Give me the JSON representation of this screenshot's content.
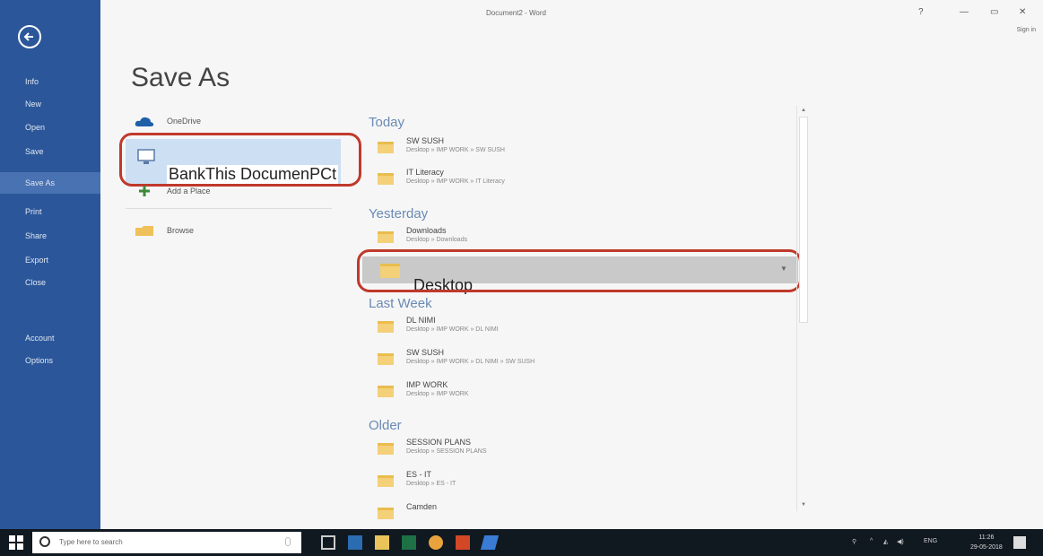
{
  "window": {
    "doc_title": "Document2 - Word",
    "help": "?",
    "minimize": "—",
    "restore": "▭",
    "close": "✕",
    "sign_in": "Sign in"
  },
  "nav": [
    "Info",
    "New",
    "Open",
    "Save",
    "Save As",
    "Print",
    "Share",
    "Export",
    "Close",
    "Account",
    "Options"
  ],
  "heading": "Save As",
  "locations": {
    "onedrive": "OneDrive",
    "this_pc": "BankThis DocumenPCt",
    "add_place": "Add a Place",
    "browse": "Browse"
  },
  "sections": {
    "today": "Today",
    "yesterday": "Yesterday",
    "last_week": "Last Week",
    "older": "Older"
  },
  "folders": {
    "today": [
      {
        "name": "SW SUSH",
        "path": "Desktop » IMP WORK » SW SUSH"
      },
      {
        "name": "IT Literacy",
        "path": "Desktop » IMP WORK » IT Literacy"
      }
    ],
    "yesterday": [
      {
        "name": "Downloads",
        "path": "Desktop » Downloads"
      }
    ],
    "desktop_label": "Desktop",
    "last_week": [
      {
        "name": "DL NIMI",
        "path": "Desktop » IMP WORK » DL NIMI"
      },
      {
        "name": "SW SUSH",
        "path": "Desktop » IMP WORK » DL NIMI » SW SUSH"
      },
      {
        "name": "IMP WORK",
        "path": "Desktop » IMP WORK"
      }
    ],
    "older": [
      {
        "name": "SESSION PLANS",
        "path": "Desktop » SESSION PLANS"
      },
      {
        "name": "ES - IT",
        "path": "Desktop » ES - IT"
      },
      {
        "name": "Camden",
        "path": ""
      }
    ]
  },
  "taskbar": {
    "search_placeholder": "Type here to search",
    "lang": "ENG",
    "time": "11:26",
    "date": "29-05-2018"
  },
  "colors": {
    "backstage": "#2b579a",
    "highlight": "#cddff2",
    "annotation": "#c0392b"
  },
  "icons": [
    "back-arrow-icon",
    "onedrive-cloud-icon",
    "computer-icon",
    "plus-icon",
    "folder-icon",
    "windows-start-icon",
    "search-icon"
  ]
}
